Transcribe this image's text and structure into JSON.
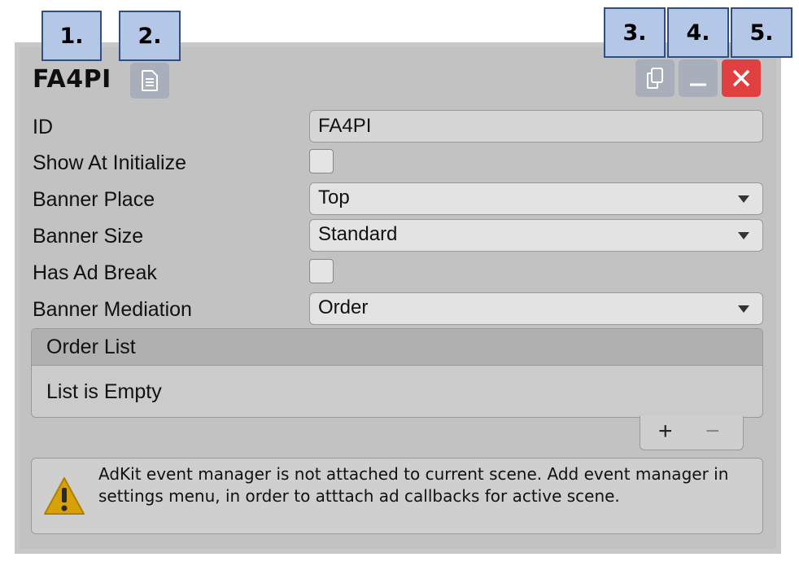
{
  "callouts": [
    "1.",
    "2.",
    "3.",
    "4.",
    "5."
  ],
  "header": {
    "title": "FA4PI",
    "doc_icon": "document-icon",
    "copy_icon": "copy-icon",
    "minimize_icon": "minimize-icon",
    "close_icon": "close-icon"
  },
  "fields": {
    "id_label": "ID",
    "id_value": "FA4PI",
    "show_at_initialize_label": "Show At Initialize",
    "banner_place_label": "Banner Place",
    "banner_place_value": "Top",
    "banner_size_label": "Banner Size",
    "banner_size_value": "Standard",
    "has_ad_break_label": "Has Ad Break",
    "banner_mediation_label": "Banner Mediation",
    "banner_mediation_value": "Order"
  },
  "order_list": {
    "header": "Order List",
    "empty_text": "List is Empty",
    "add_label": "+",
    "remove_label": "−"
  },
  "warning": {
    "icon": "warning-icon",
    "text": "AdKit event manager is not attached to current scene. Add event manager in settings menu, in order to atttach ad callbacks for active scene."
  },
  "colors": {
    "callout_fill": "#b4c7e7",
    "close_button": "#e04040",
    "header_button": "#a8afbb",
    "warning_yellow": "#d7a10a"
  }
}
